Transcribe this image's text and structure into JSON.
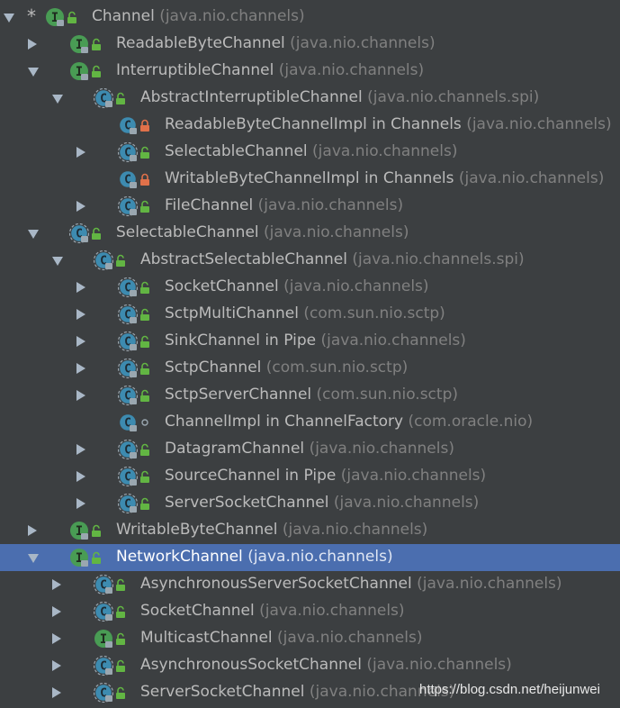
{
  "tree": [
    {
      "depth": 0,
      "expand": "down",
      "star": "*",
      "kind": "interface",
      "visibility": "public",
      "name": "Channel",
      "pkg": "(java.nio.channels)"
    },
    {
      "depth": 1,
      "expand": "right",
      "kind": "interface",
      "visibility": "public",
      "name": "ReadableByteChannel",
      "pkg": "(java.nio.channels)"
    },
    {
      "depth": 1,
      "expand": "down",
      "kind": "interface",
      "visibility": "public",
      "name": "InterruptibleChannel",
      "pkg": "(java.nio.channels)"
    },
    {
      "depth": 2,
      "expand": "down",
      "kind": "abstract-class",
      "visibility": "public",
      "name": "AbstractInterruptibleChannel",
      "pkg": "(java.nio.channels.spi)"
    },
    {
      "depth": 3,
      "expand": "none",
      "kind": "class",
      "visibility": "private",
      "name": "ReadableByteChannelImpl in Channels",
      "pkg": "(java.nio.channels)"
    },
    {
      "depth": 3,
      "expand": "right",
      "kind": "abstract-class",
      "visibility": "public",
      "name": "SelectableChannel",
      "pkg": "(java.nio.channels)"
    },
    {
      "depth": 3,
      "expand": "none",
      "kind": "class",
      "visibility": "private",
      "name": "WritableByteChannelImpl in Channels",
      "pkg": "(java.nio.channels)"
    },
    {
      "depth": 3,
      "expand": "right",
      "kind": "abstract-class",
      "visibility": "public",
      "name": "FileChannel",
      "pkg": "(java.nio.channels)"
    },
    {
      "depth": 1,
      "expand": "down",
      "kind": "abstract-class",
      "visibility": "public",
      "name": "SelectableChannel",
      "pkg": "(java.nio.channels)"
    },
    {
      "depth": 2,
      "expand": "down",
      "kind": "abstract-class",
      "visibility": "public",
      "name": "AbstractSelectableChannel",
      "pkg": "(java.nio.channels.spi)"
    },
    {
      "depth": 3,
      "expand": "right",
      "kind": "abstract-class",
      "visibility": "public",
      "name": "SocketChannel",
      "pkg": "(java.nio.channels)"
    },
    {
      "depth": 3,
      "expand": "right",
      "kind": "abstract-class",
      "visibility": "public",
      "name": "SctpMultiChannel",
      "pkg": "(com.sun.nio.sctp)"
    },
    {
      "depth": 3,
      "expand": "right",
      "kind": "abstract-class",
      "visibility": "public",
      "name": "SinkChannel in Pipe",
      "pkg": "(java.nio.channels)"
    },
    {
      "depth": 3,
      "expand": "right",
      "kind": "abstract-class",
      "visibility": "public",
      "name": "SctpChannel",
      "pkg": "(com.sun.nio.sctp)"
    },
    {
      "depth": 3,
      "expand": "right",
      "kind": "abstract-class",
      "visibility": "public",
      "name": "SctpServerChannel",
      "pkg": "(com.sun.nio.sctp)"
    },
    {
      "depth": 3,
      "expand": "none",
      "kind": "class",
      "visibility": "package",
      "name": "ChannelImpl in ChannelFactory",
      "pkg": "(com.oracle.nio)"
    },
    {
      "depth": 3,
      "expand": "right",
      "kind": "abstract-class",
      "visibility": "public",
      "name": "DatagramChannel",
      "pkg": "(java.nio.channels)"
    },
    {
      "depth": 3,
      "expand": "right",
      "kind": "abstract-class",
      "visibility": "public",
      "name": "SourceChannel in Pipe",
      "pkg": "(java.nio.channels)"
    },
    {
      "depth": 3,
      "expand": "right",
      "kind": "abstract-class",
      "visibility": "public",
      "name": "ServerSocketChannel",
      "pkg": "(java.nio.channels)"
    },
    {
      "depth": 1,
      "expand": "right",
      "kind": "interface",
      "visibility": "public",
      "name": "WritableByteChannel",
      "pkg": "(java.nio.channels)"
    },
    {
      "depth": 1,
      "expand": "down",
      "kind": "interface",
      "visibility": "public",
      "name": "NetworkChannel",
      "pkg": "(java.nio.channels)",
      "selected": true
    },
    {
      "depth": 2,
      "expand": "right",
      "kind": "abstract-class",
      "visibility": "public",
      "name": "AsynchronousServerSocketChannel",
      "pkg": "(java.nio.channels)"
    },
    {
      "depth": 2,
      "expand": "right",
      "kind": "abstract-class",
      "visibility": "public",
      "name": "SocketChannel",
      "pkg": "(java.nio.channels)"
    },
    {
      "depth": 2,
      "expand": "right",
      "kind": "interface",
      "visibility": "public",
      "name": "MulticastChannel",
      "pkg": "(java.nio.channels)"
    },
    {
      "depth": 2,
      "expand": "right",
      "kind": "abstract-class",
      "visibility": "public",
      "name": "AsynchronousSocketChannel",
      "pkg": "(java.nio.channels)"
    },
    {
      "depth": 2,
      "expand": "right",
      "kind": "abstract-class",
      "visibility": "public",
      "name": "ServerSocketChannel",
      "pkg": "(java.nio.channels)"
    }
  ],
  "watermark": "https://blog.csdn.net/heijunwei",
  "colors": {
    "background": "#3c3f41",
    "selection": "#4b6eaf",
    "interface_icon": "#499c54",
    "class_icon": "#3d8bb0",
    "public_lock": "#62b543",
    "private_lock": "#e0714a"
  }
}
